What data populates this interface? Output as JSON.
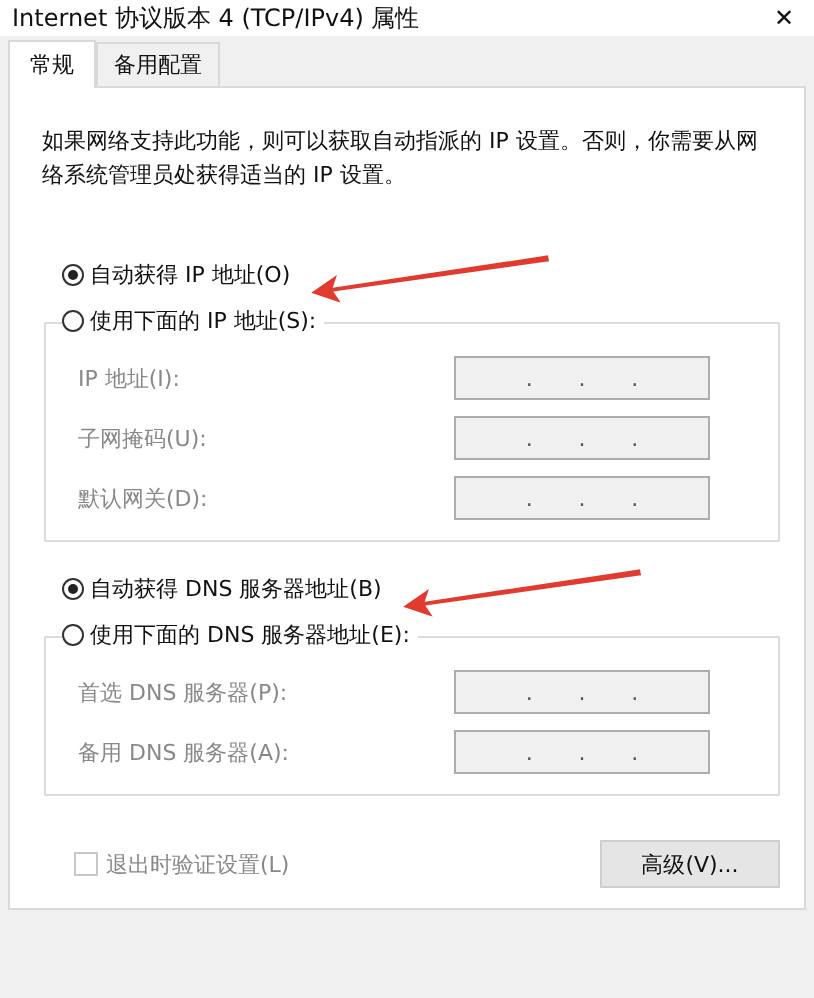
{
  "window": {
    "title": "Internet 协议版本 4 (TCP/IPv4) 属性",
    "close": "✕"
  },
  "tabs": [
    {
      "label": "常规",
      "selected": true
    },
    {
      "label": "备用配置",
      "selected": false
    }
  ],
  "description": "如果网络支持此功能，则可以获取自动指派的 IP 设置。否则，你需要从网络系统管理员处获得适当的 IP 设置。",
  "ip_section": {
    "options": [
      {
        "label": "自动获得 IP 地址(O)",
        "selected": true
      },
      {
        "label": "使用下面的 IP 地址(S):",
        "selected": false
      }
    ],
    "fields": [
      {
        "label": "IP 地址(I):",
        "disabled": true,
        "separators": [
          ".",
          ".",
          "."
        ]
      },
      {
        "label": "子网掩码(U):",
        "disabled": true,
        "separators": [
          ".",
          ".",
          "."
        ]
      },
      {
        "label": "默认网关(D):",
        "disabled": true,
        "separators": [
          ".",
          ".",
          "."
        ]
      }
    ]
  },
  "dns_section": {
    "options": [
      {
        "label": "自动获得 DNS 服务器地址(B)",
        "selected": true
      },
      {
        "label": "使用下面的 DNS 服务器地址(E):",
        "selected": false
      }
    ],
    "fields": [
      {
        "label": "首选 DNS 服务器(P):",
        "disabled": true,
        "separators": [
          ".",
          ".",
          "."
        ]
      },
      {
        "label": "备用 DNS 服务器(A):",
        "disabled": true,
        "separators": [
          ".",
          ".",
          "."
        ]
      }
    ]
  },
  "validate_checkbox": {
    "label": "退出时验证设置(L)",
    "checked": false,
    "disabled": true
  },
  "advanced_button": {
    "label": "高级(V)..."
  }
}
